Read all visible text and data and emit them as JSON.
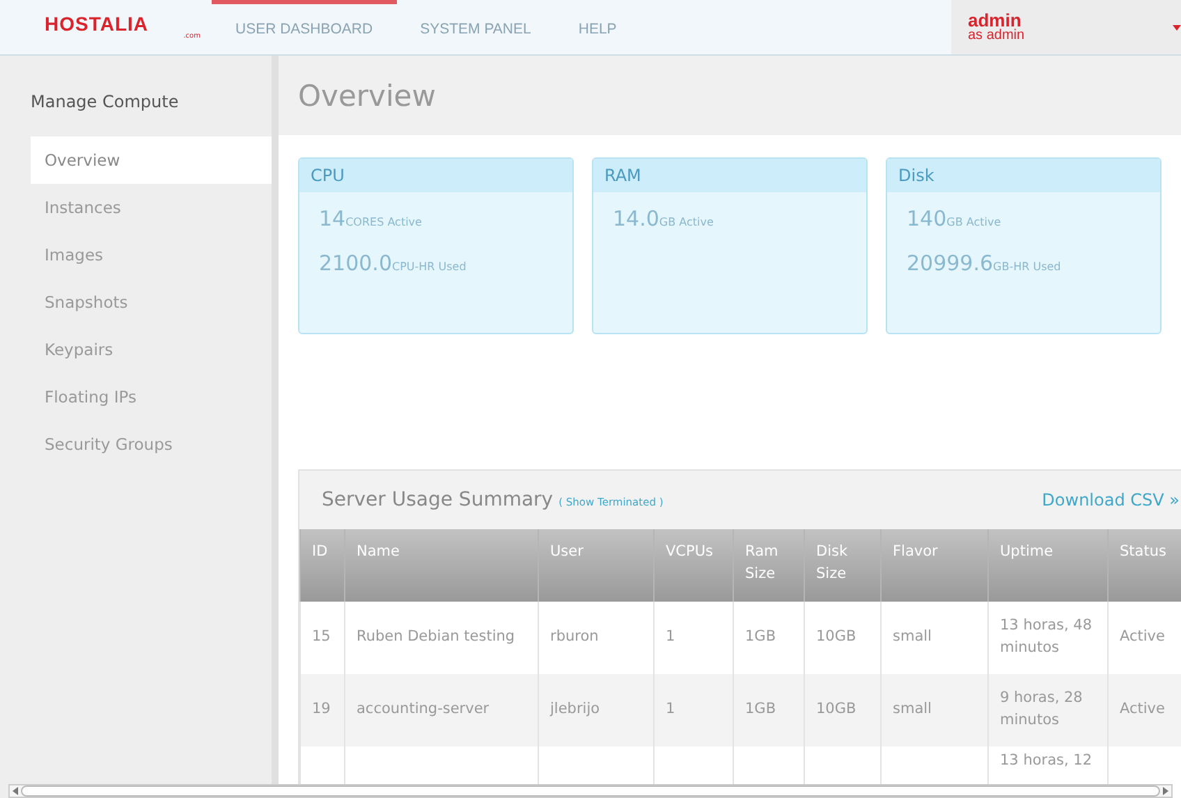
{
  "nav": {
    "logo": "HOSTALIA",
    "logo_sub": ".com",
    "tabs": [
      {
        "label": "USER DASHBOARD",
        "selected": true
      },
      {
        "label": "SYSTEM PANEL",
        "selected": false
      },
      {
        "label": "HELP",
        "selected": false
      }
    ],
    "user": {
      "name": "admin",
      "role": "as admin"
    }
  },
  "sidebar": {
    "heading": "Manage Compute",
    "items": [
      {
        "label": "Overview",
        "selected": true
      },
      {
        "label": "Instances",
        "selected": false
      },
      {
        "label": "Images",
        "selected": false
      },
      {
        "label": "Snapshots",
        "selected": false
      },
      {
        "label": "Keypairs",
        "selected": false
      },
      {
        "label": "Floating IPs",
        "selected": false
      },
      {
        "label": "Security Groups",
        "selected": false
      }
    ]
  },
  "page_title": "Overview",
  "cards": [
    {
      "title": "CPU",
      "stats": [
        {
          "value": "14",
          "unit": "CORES Active"
        },
        {
          "value": "2100.0",
          "unit": "CPU-HR Used"
        }
      ]
    },
    {
      "title": "RAM",
      "stats": [
        {
          "value": "14.0",
          "unit": "GB Active"
        }
      ]
    },
    {
      "title": "Disk",
      "stats": [
        {
          "value": "140",
          "unit": "GB Active"
        },
        {
          "value": "20999.6",
          "unit": "GB-HR Used"
        }
      ]
    }
  ],
  "usage": {
    "title": "Server Usage Summary",
    "show_terminated": "( Show Terminated )",
    "download": "Download CSV »",
    "columns": [
      "ID",
      "Name",
      "User",
      "VCPUs",
      "Ram Size",
      "Disk Size",
      "Flavor",
      "Uptime",
      "Status"
    ],
    "rows": [
      [
        "15",
        "Ruben Debian testing",
        "rburon",
        "1",
        "1GB",
        "10GB",
        "small",
        "13 horas, 48 minutos",
        "Active"
      ],
      [
        "19",
        "accounting-server",
        "jlebrijo",
        "1",
        "1GB",
        "10GB",
        "small",
        "9 horas, 28 minutos",
        "Active"
      ],
      [
        null,
        null,
        null,
        null,
        null,
        null,
        null,
        "13 horas, 12",
        null
      ]
    ]
  }
}
